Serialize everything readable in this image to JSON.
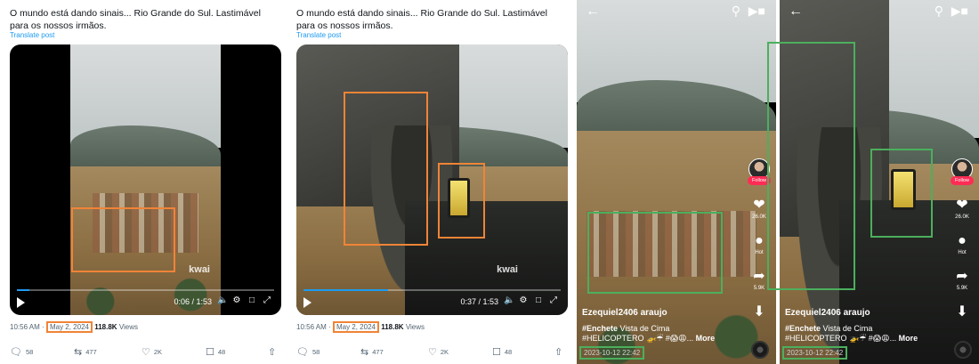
{
  "tweet": {
    "caption": "O mundo está dando sinais... Rio Grande do Sul. Lastimável para os nossos irmãos.",
    "translate_label": "Translate post",
    "time": "10:56 AM",
    "separator": "·",
    "date": "May 2, 2024",
    "views_count": "118.8K",
    "views_label": "Views",
    "replies": "58",
    "reposts": "477",
    "likes": "2K",
    "bookmarks": "48",
    "watermark": "kwai"
  },
  "videos": [
    {
      "timecode": "0:06 / 1:53",
      "progress": 0.05
    },
    {
      "timecode": "0:37 / 1:53",
      "progress": 0.33
    }
  ],
  "tiktok": {
    "follow_label": "Follow",
    "likes": "26.0K",
    "comments": "Hot",
    "shares": "5.9K",
    "username": "Ezequiel2406 araujo",
    "description_hashtag": "#Enchete",
    "description_text": " Vista de Cima #HELICOPTERO 🚁☔ #😱😩...",
    "more_label": "More",
    "timestamp": "2023-10-12 22:42"
  },
  "colors": {
    "highlight_orange": "#f08437",
    "highlight_green": "#4caf5d",
    "link_blue": "#1d9bf0",
    "follow_red": "#fe2c55"
  }
}
